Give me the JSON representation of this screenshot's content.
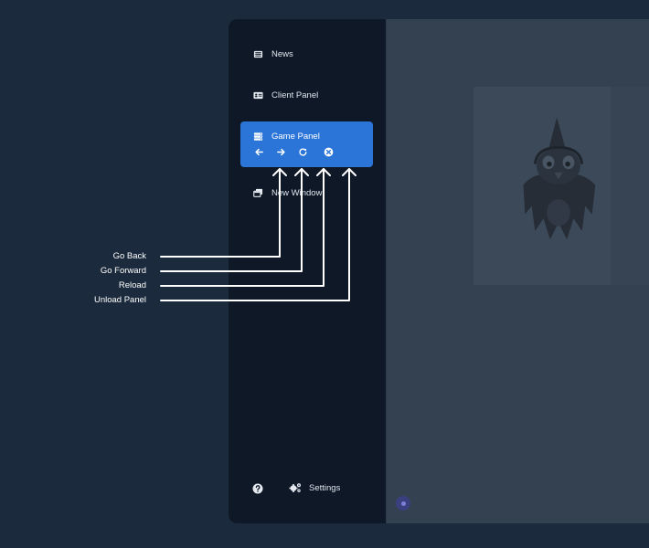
{
  "sidebar": {
    "items": [
      {
        "label": "News",
        "icon": "newspaper-icon"
      },
      {
        "label": "Client Panel",
        "icon": "id-card-icon"
      },
      {
        "label": "Game Panel",
        "icon": "server-icon",
        "active": true
      },
      {
        "label": "New Window",
        "icon": "windows-icon"
      }
    ],
    "game_panel_controls": [
      {
        "name": "go-back",
        "icon": "arrow-left-icon"
      },
      {
        "name": "go-forward",
        "icon": "arrow-right-icon"
      },
      {
        "name": "reload",
        "icon": "reload-icon"
      },
      {
        "name": "unload-panel",
        "icon": "close-circle-icon"
      }
    ],
    "footer": {
      "help_icon": "question-circle-icon",
      "settings_label": "Settings",
      "settings_icon": "gears-icon"
    }
  },
  "callouts": {
    "go_back": "Go Back",
    "go_forward": "Go Forward",
    "reload": "Reload",
    "unload_panel": "Unload Panel"
  },
  "colors": {
    "background": "#1b2a3c",
    "sidebar": "#0e1826",
    "accent": "#2c75d8",
    "content": "#334151"
  }
}
